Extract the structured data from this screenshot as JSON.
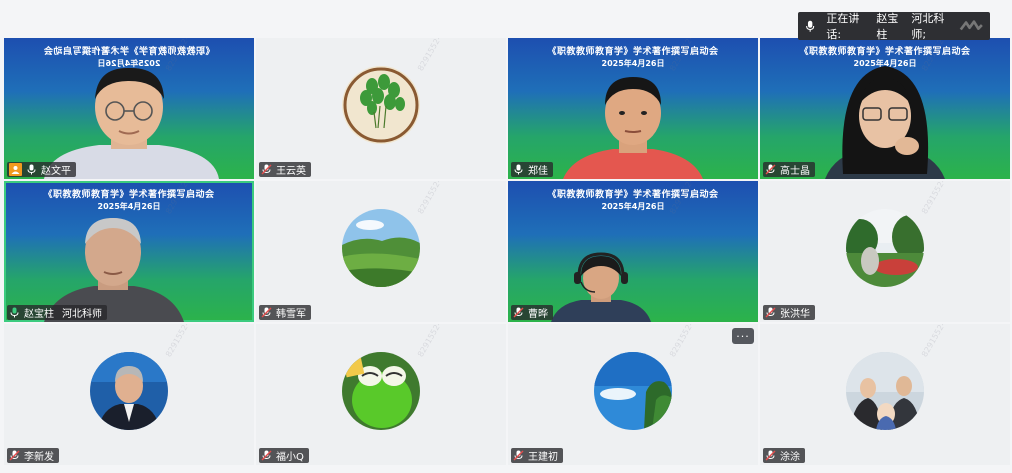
{
  "speaking": {
    "label": "正在讲话:",
    "name": "赵宝柱",
    "org": "河北科师;"
  },
  "banner": {
    "title": "《职教教师教育学》学术著作撰写启动会",
    "date": "2025年4月26日"
  },
  "watermark": "8291552-3211-4f88-8654 2376 ... 7302",
  "tiles": [
    {
      "name": "赵文平"
    },
    {
      "name": "王云英"
    },
    {
      "name": "郑佳"
    },
    {
      "name": "高士晶"
    },
    {
      "name": "赵宝柱",
      "org": "河北科师"
    },
    {
      "name": "韩雪军"
    },
    {
      "name": "曹晔"
    },
    {
      "name": "张洪华"
    },
    {
      "name": "李新发"
    },
    {
      "name": "福小Q"
    },
    {
      "name": "王建初"
    },
    {
      "name": "涂涂"
    }
  ],
  "more_label": "···",
  "colors": {
    "accent_active": "#3ccb7f",
    "host_badge": "#f29a1f"
  }
}
